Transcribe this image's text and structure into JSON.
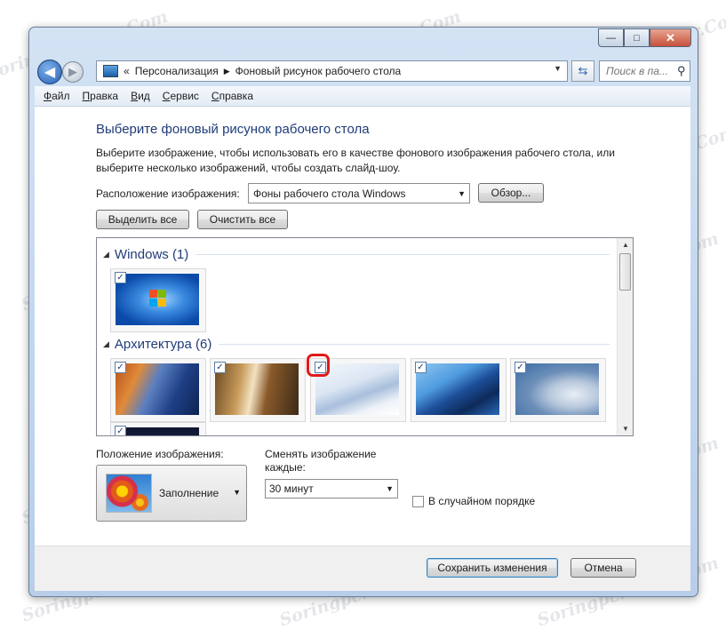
{
  "watermark": "Soringpcrepair.Com",
  "window": {
    "controls": {
      "minimize": "—",
      "maximize": "□",
      "close": "✕"
    },
    "nav": {
      "back_icon": "arrow-left-icon",
      "forward_icon": "arrow-right-icon"
    },
    "address": {
      "crumbs_prefix": "«",
      "crumbs": [
        "Персонализация",
        "Фоновый рисунок рабочего стола"
      ],
      "separator": "▶"
    },
    "refresh_icon": "refresh-icon",
    "search": {
      "placeholder": "Поиск в па...",
      "icon": "magnifier-icon"
    }
  },
  "menubar": [
    "Файл",
    "Правка",
    "Вид",
    "Сервис",
    "Справка"
  ],
  "main": {
    "title": "Выберите фоновый рисунок рабочего стола",
    "description": "Выберите изображение, чтобы использовать его в качестве фонового изображения рабочего стола, или выберите несколько изображений, чтобы создать слайд-шоу.",
    "location_label": "Расположение изображения:",
    "location_value": "Фоны рабочего стола Windows",
    "browse_button": "Обзор...",
    "select_all_button": "Выделить все",
    "clear_all_button": "Очистить все",
    "groups": [
      {
        "name": "Windows (1)",
        "images": [
          {
            "name": "windows-logo-wallpaper",
            "checked": true
          }
        ]
      },
      {
        "name": "Архитектура (6)",
        "images": [
          {
            "name": "architecture-1",
            "checked": true
          },
          {
            "name": "architecture-2",
            "checked": true
          },
          {
            "name": "architecture-3",
            "checked": true,
            "highlighted": true
          },
          {
            "name": "architecture-4",
            "checked": true
          },
          {
            "name": "architecture-5",
            "checked": true
          },
          {
            "name": "architecture-6",
            "checked": true
          }
        ]
      }
    ],
    "checkmark": "✓",
    "position_label": "Положение изображения:",
    "position_value": "Заполнение",
    "change_label": "Сменять изображение каждые:",
    "interval_value": "30 минут",
    "shuffle_label": "В случайном порядке",
    "shuffle_checked": false
  },
  "footer": {
    "save_button": "Сохранить изменения",
    "cancel_button": "Отмена"
  },
  "colors": {
    "highlight": "#e11a1a",
    "heading": "#1f3c79"
  }
}
